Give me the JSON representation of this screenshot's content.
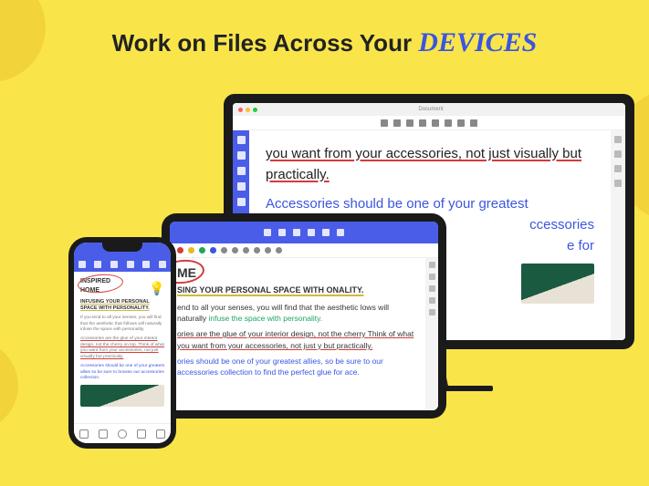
{
  "headline": {
    "main": "Work on Files Across Your ",
    "accent": "DEVICES"
  },
  "desktop": {
    "window_title": "Document",
    "text_line1": "you want from your accessories, not just visually but practically.",
    "text_line2a": "Accessories should be one of your greatest",
    "text_line2b": "ccessories",
    "text_line2c": "e for"
  },
  "tablet": {
    "heading": "ME",
    "subheading": "SING YOUR PERSONAL SPACE WITH ONALITY.",
    "para1a": "end to all your senses, you will find that the aesthetic lows will naturally ",
    "para1_green": "infuse the space with personality.",
    "para2": "ories are the glue of your interior design, not the cherry Think of what you want from your accessories, not just y but practically.",
    "para3": "ories should be one of your greatest allies, so be sure to our accessories collection to find the perfect glue for ace."
  },
  "phone": {
    "heading_l1": "INSPIRED",
    "heading_l2": "HOME",
    "subheading": "INFUSING YOUR PERSONAL SPACE WITH PERSONALITY.",
    "para1": "If you tend to all your senses, you will find that the aesthetic that follows will naturally infuse the space with personality.",
    "para2": "Accessories are the glue of your interior design, not the cherry on top. Think of what you want from your accessories, not just visually but practically.",
    "para3": "Accessories should be one of your greatest allies so be sure to browse our accessories collection."
  }
}
